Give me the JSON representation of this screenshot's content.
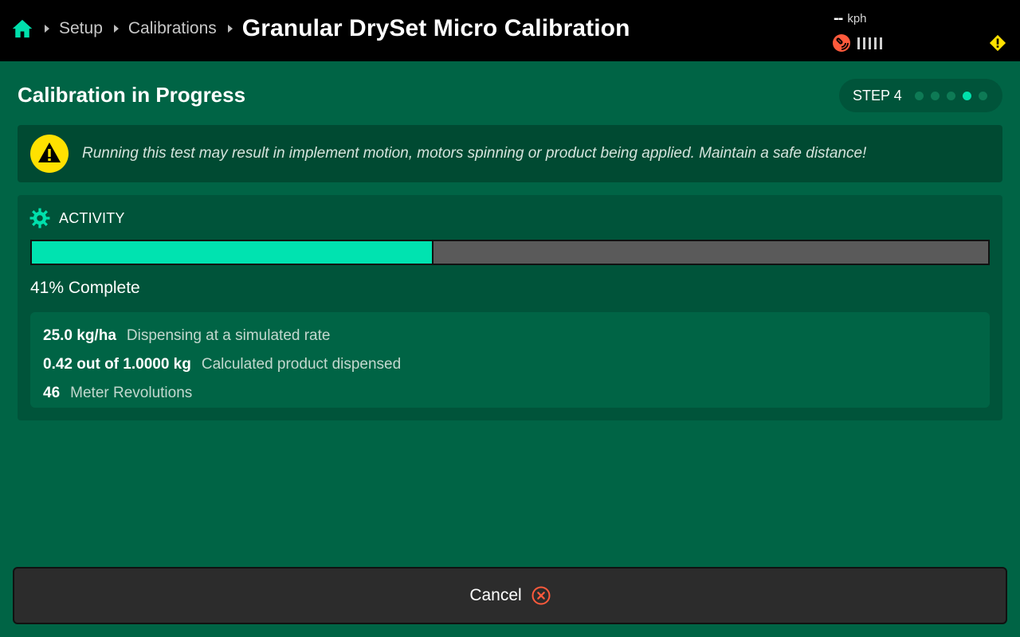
{
  "header": {
    "breadcrumbs": [
      "Setup",
      "Calibrations"
    ],
    "title": "Granular DrySet Micro Calibration",
    "speed": {
      "value": "--",
      "unit": "kph"
    },
    "icons": {
      "home": "home-icon",
      "gps": "gps-signal-icon",
      "alert": "warning-diamond-icon"
    },
    "colors": {
      "home": "#00e0ac",
      "gps": "#ff5a3c",
      "alert": "#ffe100"
    }
  },
  "main": {
    "section_title": "Calibration in Progress",
    "step": {
      "label": "STEP 4",
      "total": 5,
      "current": 4
    },
    "warning": {
      "icon": "warning-triangle-icon",
      "text": "Running this test may result in implement motion, motors spinning or product being applied. Maintain a safe distance!"
    },
    "activity": {
      "icon": "gear-icon",
      "title": "ACTIVITY",
      "progress_fraction": 0.42,
      "complete_text": "41% Complete",
      "stats": [
        {
          "value": "25.0 kg/ha",
          "desc": "Dispensing at a simulated rate"
        },
        {
          "value": "0.42 out of 1.0000 kg",
          "desc": "Calculated product dispensed"
        },
        {
          "value": "46",
          "desc": "Meter Revolutions"
        }
      ]
    }
  },
  "footer": {
    "cancel_label": "Cancel",
    "cancel_icon": "cancel-x-icon",
    "accent": "#00e3b0"
  }
}
